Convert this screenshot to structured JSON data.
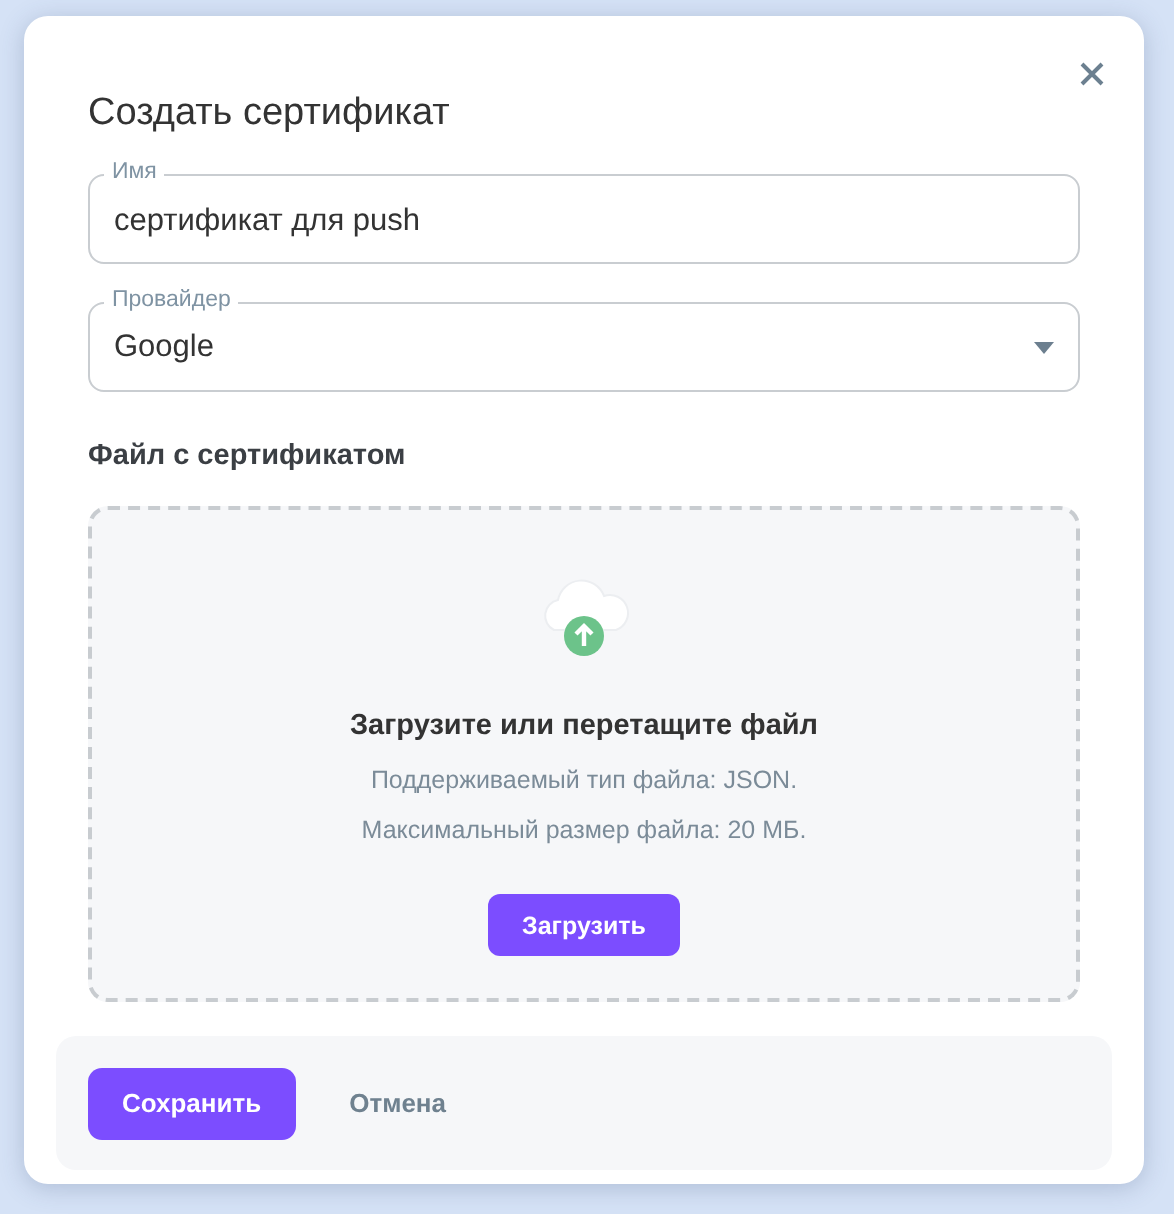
{
  "dialog": {
    "title": "Создать сертификат"
  },
  "fields": [
    {
      "kind": "text",
      "label": "Имя",
      "value": "сертификат для push"
    },
    {
      "kind": "select",
      "label": "Провайдер",
      "value": "Google"
    }
  ],
  "file_section": {
    "label": "Файл с сертификатом",
    "heading": "Загрузите или перетащите файл",
    "hints": [
      "Поддерживаемый тип файла: JSON.",
      "Максимальный размер файла: 20 МБ."
    ],
    "button": "Загрузить"
  },
  "footer": {
    "buttons": [
      {
        "kind": "primary",
        "label": "Сохранить"
      },
      {
        "kind": "text",
        "label": "Отмена"
      }
    ]
  }
}
